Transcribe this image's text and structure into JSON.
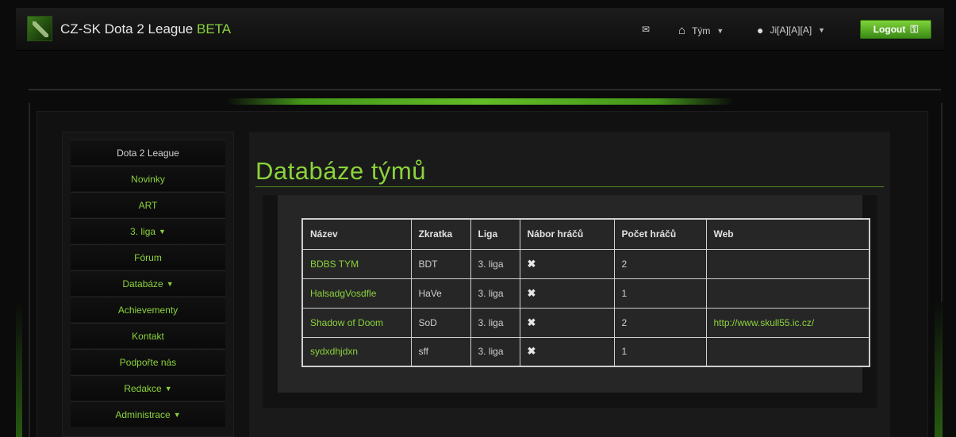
{
  "navbar": {
    "brand": "CZ-SK Dota 2 League",
    "brand_suffix": "BETA",
    "mail_icon": "envelope-icon",
    "team_label": "Tým",
    "user_label": "Ji[A][A][A]",
    "logout_label": "Logout"
  },
  "sidebar": {
    "items": [
      {
        "label": "Dota 2 League",
        "dropdown": false
      },
      {
        "label": "Novinky",
        "dropdown": false
      },
      {
        "label": "ART",
        "dropdown": false
      },
      {
        "label": "3. liga",
        "dropdown": true
      },
      {
        "label": "Fórum",
        "dropdown": false
      },
      {
        "label": "Databáze",
        "dropdown": true
      },
      {
        "label": "Achievementy",
        "dropdown": false
      },
      {
        "label": "Kontakt",
        "dropdown": false
      },
      {
        "label": "Podpořte nás",
        "dropdown": false
      },
      {
        "label": "Redakce",
        "dropdown": true
      },
      {
        "label": "Administrace",
        "dropdown": true
      }
    ]
  },
  "main": {
    "title": "Databáze týmů",
    "table": {
      "headers": [
        "Název",
        "Zkratka",
        "Liga",
        "Nábor hráčů",
        "Počet hráčů",
        "Web"
      ],
      "rows": [
        {
          "name": "BDBS TYM",
          "abbr": "BDT",
          "league": "3. liga",
          "recruiting": false,
          "players": "2",
          "web": ""
        },
        {
          "name": "HalsadgVosdfle",
          "abbr": "HaVe",
          "league": "3. liga",
          "recruiting": false,
          "players": "1",
          "web": ""
        },
        {
          "name": "Shadow of Doom",
          "abbr": "SoD",
          "league": "3. liga",
          "recruiting": false,
          "players": "2",
          "web": "http://www.skull55.ic.cz/"
        },
        {
          "name": "sydxdhjdxn",
          "abbr": "sff",
          "league": "3. liga",
          "recruiting": false,
          "players": "1",
          "web": ""
        }
      ]
    }
  },
  "colors": {
    "accent": "#8bd33b",
    "background": "#0b0b0b",
    "panel": "#262626"
  }
}
